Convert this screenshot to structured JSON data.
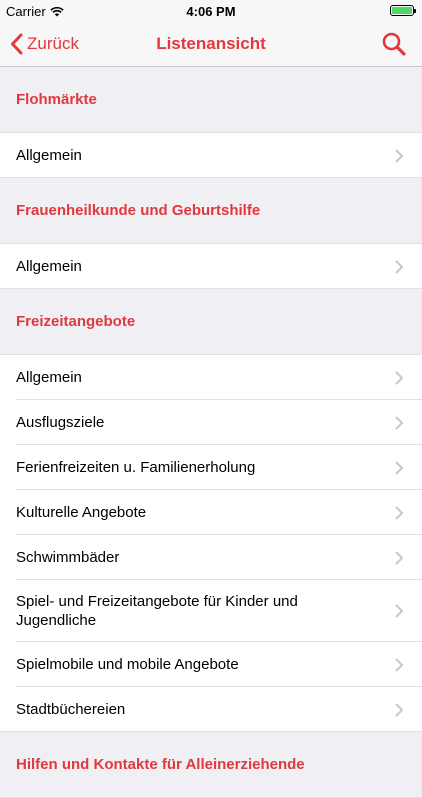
{
  "status": {
    "carrier": "Carrier",
    "time": "4:06 PM",
    "battery_level": 1.0
  },
  "nav": {
    "back_label": "Zurück",
    "title": "Listenansicht"
  },
  "icons": {
    "back": "chevron-left-icon",
    "search": "search-icon",
    "row": "chevron-right-icon"
  },
  "colors": {
    "accent": "#e0393e",
    "section_bg": "#efeff4"
  },
  "sections": [
    {
      "title": "Flohmärkte",
      "items": [
        "Allgemein"
      ]
    },
    {
      "title": "Frauenheilkunde und Geburtshilfe",
      "items": [
        "Allgemein"
      ]
    },
    {
      "title": "Freizeitangebote",
      "items": [
        "Allgemein",
        "Ausflugsziele",
        "Ferienfreizeiten u. Familienerholung",
        "Kulturelle Angebote",
        "Schwimmbäder",
        "Spiel- und Freizeitangebote für Kinder und Jugendliche",
        "Spielmobile und mobile Angebote",
        "Stadtbüchereien"
      ]
    },
    {
      "title": "Hilfen und Kontakte für Alleinerziehende",
      "items": []
    }
  ]
}
